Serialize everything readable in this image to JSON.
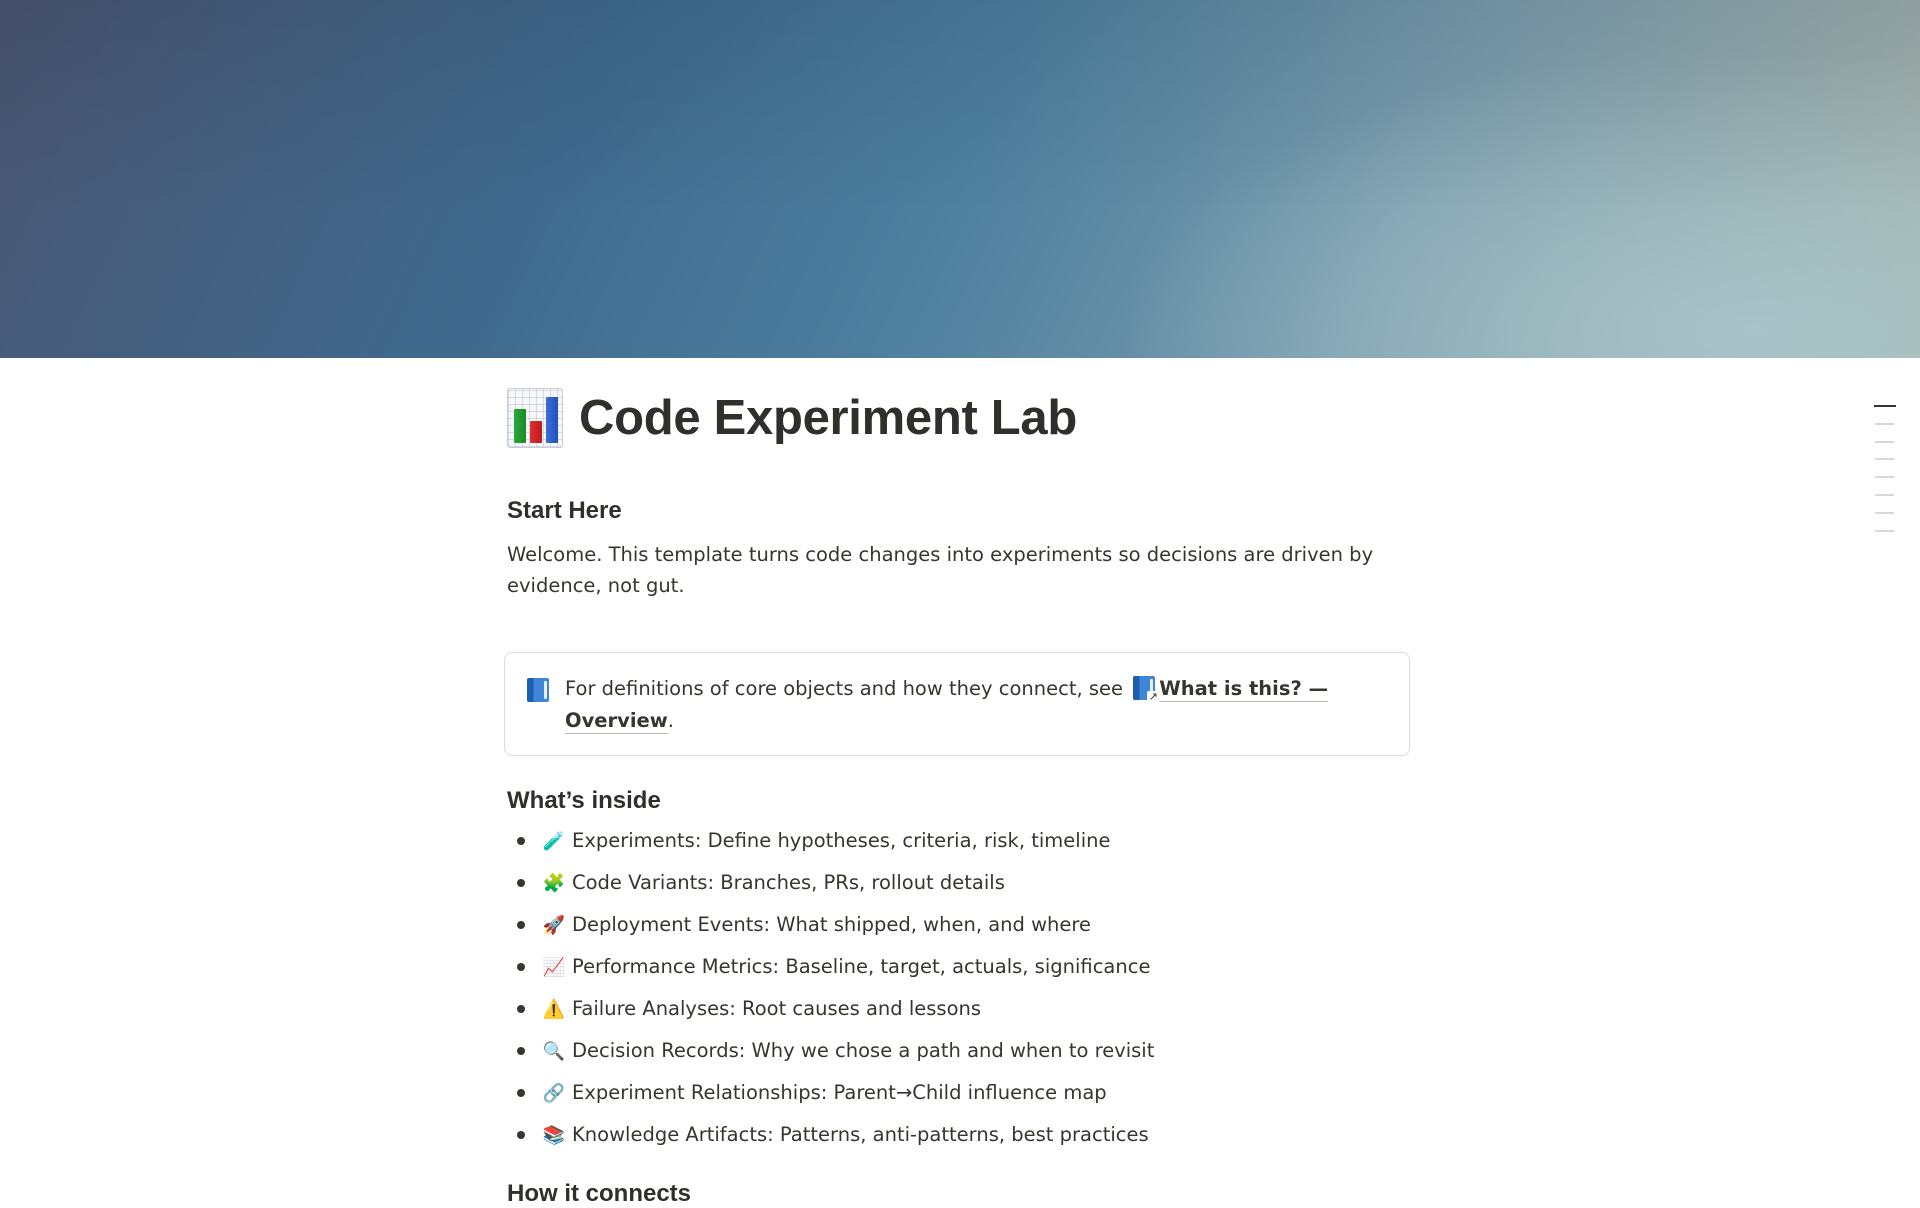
{
  "page": {
    "title": "Code Experiment Lab",
    "title_icon": "bar-chart-icon"
  },
  "start_here": {
    "heading": "Start Here",
    "intro": "Welcome. This template turns code changes into experiments so decisions are driven by evidence, not gut."
  },
  "callout": {
    "icon": "blue-book-icon",
    "text_before": "For definitions of core objects and how they connect, see ",
    "link_text": "What is this? — Overview",
    "text_after": "."
  },
  "whats_inside": {
    "heading": "What’s inside",
    "items": [
      {
        "icon": "🧪",
        "icon_name": "test-tube-icon",
        "text": "Experiments: Define hypotheses, criteria, risk, timeline"
      },
      {
        "icon": "🧩",
        "icon_name": "puzzle-piece-icon",
        "text": "Code Variants: Branches, PRs, rollout details"
      },
      {
        "icon": "🚀",
        "icon_name": "rocket-icon",
        "text": "Deployment Events: What shipped, when, and where"
      },
      {
        "icon": "📈",
        "icon_name": "chart-increasing-icon",
        "text": "Performance Metrics: Baseline, target, actuals, significance"
      },
      {
        "icon": "⚠️",
        "icon_name": "warning-icon",
        "text": "Failure Analyses: Root causes and lessons"
      },
      {
        "icon": "🔍",
        "icon_name": "magnifying-glass-icon",
        "text": "Decision Records: Why we chose a path and when to revisit"
      },
      {
        "icon": "🔗",
        "icon_name": "link-icon",
        "text": "Experiment Relationships: Parent→Child influence map"
      },
      {
        "icon": "📚",
        "icon_name": "books-icon",
        "text": "Knowledge Artifacts: Patterns, anti-patterns, best practices"
      }
    ]
  },
  "next_heading": "How it connects",
  "colors": {
    "text": "#37352f",
    "callout_border": "#dedcd7",
    "toc_active": "#37352f",
    "toc_inactive": "#d9d8d4"
  }
}
